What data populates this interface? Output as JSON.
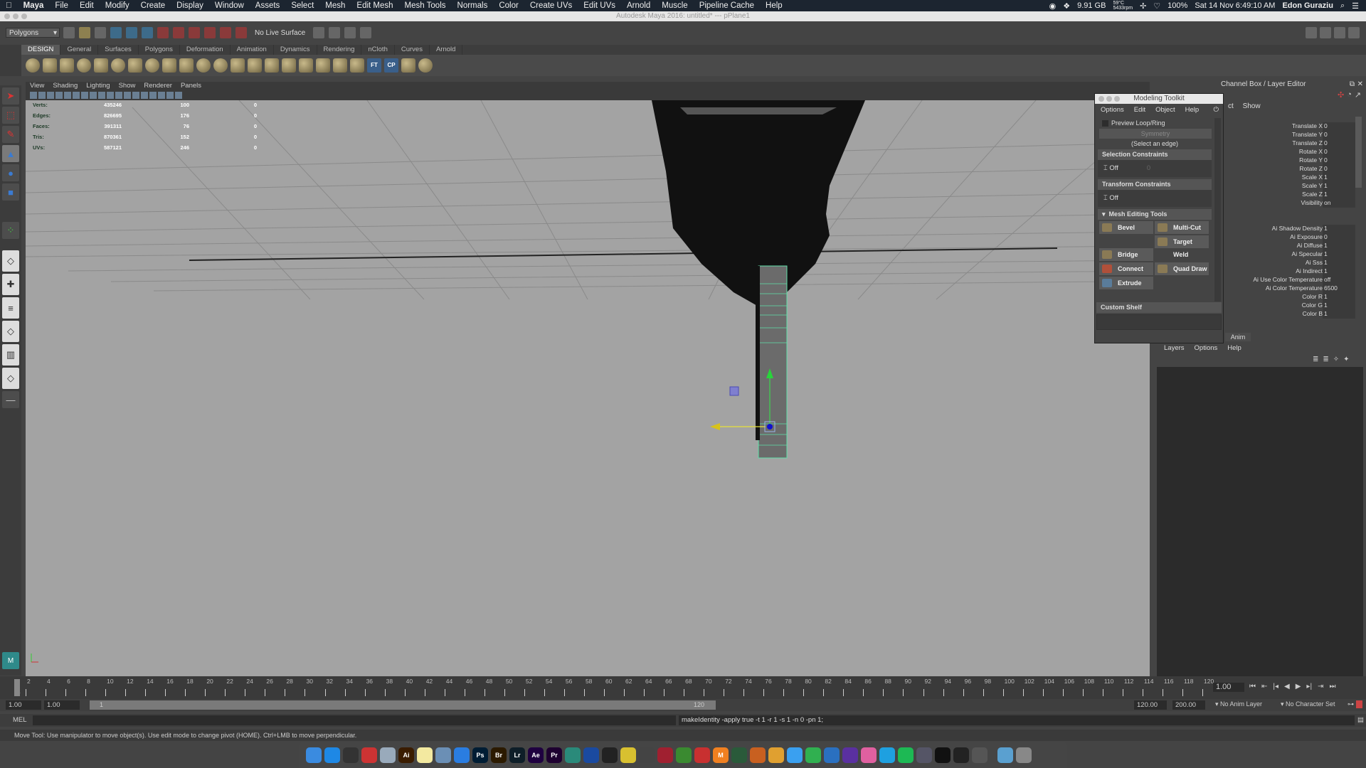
{
  "mac_menubar": {
    "apple": "",
    "app_name": "Maya",
    "items": [
      "File",
      "Edit",
      "Modify",
      "Create",
      "Display",
      "Window",
      "Assets",
      "Select",
      "Mesh",
      "Edit Mesh",
      "Mesh Tools",
      "Normals",
      "Color",
      "Create UVs",
      "Edit UVs",
      "Arnold",
      "Muscle",
      "Pipeline Cache",
      "Help"
    ],
    "status": {
      "memory": "9.91 GB",
      "temp": "59°C",
      "rpm": "5433rpm",
      "battery": "100%",
      "datetime": "Sat 14 Nov  6:49:10 AM",
      "user": "Edon Guraziu"
    }
  },
  "window_title": "Autodesk Maya 2016: untitled* --- pPlane1",
  "status_line": {
    "menu_set": "Polygons",
    "live_surface": "No Live Surface"
  },
  "shelf": {
    "tabs": [
      "DESIGN",
      "General",
      "Surfaces",
      "Polygons",
      "Deformation",
      "Animation",
      "Dynamics",
      "Rendering",
      "nCloth",
      "Curves",
      "Arnold"
    ],
    "active_tab": "DESIGN",
    "text_icons": [
      "FT",
      "CP"
    ]
  },
  "viewport": {
    "menu": [
      "View",
      "Shading",
      "Lighting",
      "Show",
      "Renderer",
      "Panels"
    ],
    "hud": [
      {
        "label": "Verts:",
        "total": "435246",
        "selected": "100",
        "third": "0"
      },
      {
        "label": "Edges:",
        "total": "826695",
        "selected": "176",
        "third": "0"
      },
      {
        "label": "Faces:",
        "total": "391311",
        "selected": "76",
        "third": "0"
      },
      {
        "label": "Tris:",
        "total": "870361",
        "selected": "152",
        "third": "0"
      },
      {
        "label": "UVs:",
        "total": "587121",
        "selected": "246",
        "third": "0"
      }
    ]
  },
  "modeling_toolkit": {
    "title": "Modeling Toolkit",
    "menu": [
      "Options",
      "Edit",
      "Object",
      "Help"
    ],
    "preview_loop": "Preview Loop/Ring",
    "symmetry": "Symmetry",
    "select_hint": "(Select an edge)",
    "selection_constraints": {
      "header": "Selection Constraints",
      "value": "Off",
      "field": "0"
    },
    "transform_constraints": {
      "header": "Transform Constraints",
      "value": "Off"
    },
    "mesh_editing": {
      "header": "Mesh Editing Tools",
      "tools": [
        "Bevel",
        "Multi-Cut",
        "Bridge",
        "Target Weld",
        "Connect",
        "Quad Draw",
        "Extrude"
      ]
    },
    "custom_shelf": "Custom Shelf"
  },
  "channel_box": {
    "title": "Channel Box / Layer Editor",
    "menu_partial": "ct",
    "show": "Show",
    "channels": [
      {
        "name": "Translate X",
        "value": "0"
      },
      {
        "name": "Translate Y",
        "value": "0"
      },
      {
        "name": "Translate Z",
        "value": "0"
      },
      {
        "name": "Rotate X",
        "value": "0"
      },
      {
        "name": "Rotate Y",
        "value": "0"
      },
      {
        "name": "Rotate Z",
        "value": "0"
      },
      {
        "name": "Scale X",
        "value": "1"
      },
      {
        "name": "Scale Y",
        "value": "1"
      },
      {
        "name": "Scale Z",
        "value": "1"
      },
      {
        "name": "Visibility",
        "value": "on"
      }
    ],
    "shape_channels": [
      {
        "name": "Ai Shadow Density",
        "value": "1"
      },
      {
        "name": "Ai Exposure",
        "value": "0"
      },
      {
        "name": "Ai Diffuse",
        "value": "1"
      },
      {
        "name": "Ai Specular",
        "value": "1"
      },
      {
        "name": "Ai Sss",
        "value": "1"
      },
      {
        "name": "Ai Indirect",
        "value": "1"
      },
      {
        "name": "Ai Use Color Temperature",
        "value": "off"
      },
      {
        "name": "Ai Color Temperature",
        "value": "6500"
      },
      {
        "name": "Color R",
        "value": "1"
      },
      {
        "name": "Color G",
        "value": "1"
      },
      {
        "name": "Color B",
        "value": "1"
      }
    ],
    "anim_tab": "Anim",
    "layer_menu": [
      "Layers",
      "Options",
      "Help"
    ]
  },
  "timeline": {
    "ticks": [
      "1",
      "2",
      "4",
      "6",
      "8",
      "10",
      "12",
      "14",
      "16",
      "18",
      "20",
      "22",
      "24",
      "26",
      "28",
      "30",
      "32",
      "34",
      "36",
      "38",
      "40",
      "42",
      "44",
      "46",
      "48",
      "50",
      "52",
      "54",
      "56",
      "58",
      "60",
      "62",
      "64",
      "66",
      "68",
      "70",
      "72",
      "74",
      "76",
      "78",
      "80",
      "82",
      "84",
      "86",
      "88",
      "90",
      "92",
      "94",
      "96",
      "98",
      "100",
      "102",
      "104",
      "106",
      "108",
      "110",
      "112",
      "114",
      "116",
      "118",
      "120"
    ],
    "current_frame": "1.00"
  },
  "range": {
    "start": "1.00",
    "inner_start": "1.00",
    "slider_start": "1",
    "slider_end": "120",
    "inner_end": "120.00",
    "end": "200.00",
    "anim_layer": "No Anim Layer",
    "char_set": "No Character Set"
  },
  "command_line": {
    "mode": "MEL",
    "result": "makeIdentity -apply true -t 1 -r 1 -s 1 -n 0 -pn 1;"
  },
  "help_line": "Move Tool: Use manipulator to move object(s). Use edit mode to change pivot (HOME).  Ctrl+LMB to move perpendicular.",
  "dock": [
    "Finder",
    "App Store",
    "QuickTime",
    "Calendar",
    "Preview",
    "Ai",
    "Notes",
    "Mail",
    "Safari",
    "Ps",
    "Br",
    "Lr",
    "Ae",
    "Pr",
    "Maya",
    "Keyshot",
    "Cinema4D",
    "Idea",
    "Xcode",
    "Davinci",
    "Toolbox",
    "Sketchup",
    "M",
    "Vectorworks",
    "Substance",
    "Photos",
    "Messages",
    "FaceTime",
    "Keynote",
    "iMovie",
    "iTunes",
    "Skype",
    "Spotify",
    "Utility",
    "Terminal",
    "OBS",
    "Settings",
    "Folder",
    "Trash"
  ]
}
